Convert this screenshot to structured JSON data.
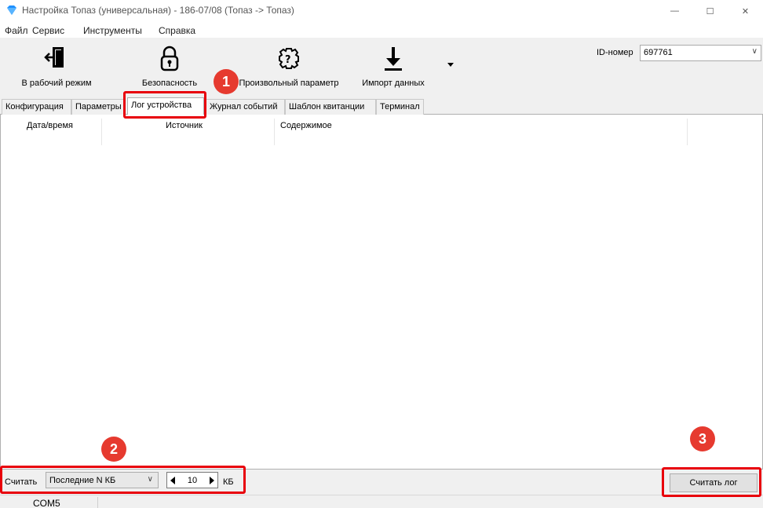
{
  "window": {
    "title": "Настройка Топаз (универсальная) - 186-07/08 (Топаз -> Топаз)",
    "minimize": "—",
    "maximize": "☐",
    "close": "✕"
  },
  "menu": [
    "Файл",
    "Сервис",
    "Инструменты",
    "Справка"
  ],
  "toolbar": {
    "work_mode": "В рабочий режим",
    "security": "Безопасность",
    "param": "Произвольный параметр",
    "import": "Импорт данных"
  },
  "id_field": {
    "label": "ID-номер",
    "value": "697761"
  },
  "tabs": [
    "Конфигурация",
    "Параметры",
    "Лог устройства",
    "Журнал событий",
    "Шаблон квитанции",
    "Терминал"
  ],
  "active_tab": "Лог устройства",
  "columns": [
    "Дата/время",
    "Источник",
    "Содержимое"
  ],
  "bottom": {
    "read_label": "Считать",
    "mode_value": "Последние N КБ",
    "count_value": "10",
    "unit": "КБ",
    "read_button": "Считать лог"
  },
  "status": {
    "port": "COM5"
  },
  "markers": [
    "1",
    "2",
    "3"
  ],
  "colors": {
    "highlight": "#e8000b",
    "marker": "#e63a2f",
    "icon_accent": "#1e90ff"
  },
  "icons": [
    "diamond-icon",
    "door-exit-icon",
    "padlock-icon",
    "gear-question-icon",
    "download-icon"
  ]
}
